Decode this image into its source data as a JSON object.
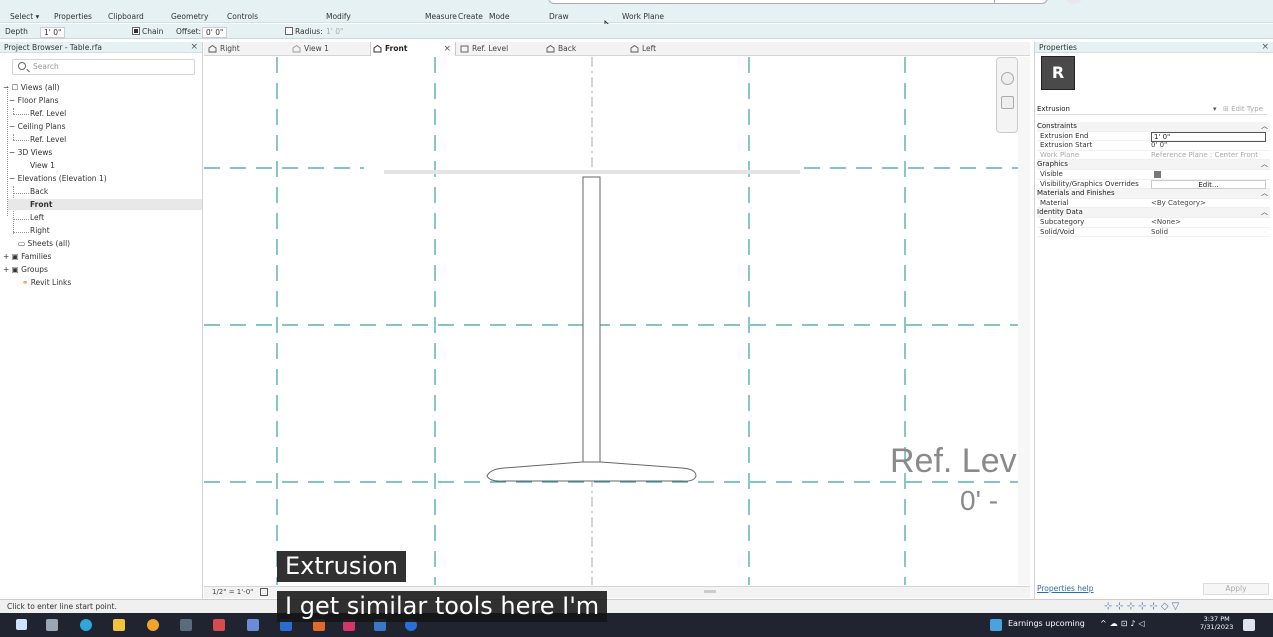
{
  "ribbon": {
    "items": [
      "Select",
      "Properties",
      "Clipboard",
      "Geometry",
      "Controls",
      "Modify",
      "Measure",
      "Create",
      "Mode",
      "Draw",
      "Work Plane"
    ]
  },
  "options": {
    "depth_label": "Depth",
    "depth_value": "1' 0\"",
    "chain_label": "Chain",
    "offset_label": "Offset:",
    "offset_value": "0' 0\"",
    "radius_label": "Radius:",
    "radius_value": "1' 0\""
  },
  "project_browser": {
    "title": "Project Browser - Table.rfa",
    "search_placeholder": "Search",
    "items": [
      {
        "label": "Views (all)"
      },
      {
        "label": "Floor Plans"
      },
      {
        "label": "Ref. Level"
      },
      {
        "label": "Ceiling Plans"
      },
      {
        "label": "Ref. Level"
      },
      {
        "label": "3D Views"
      },
      {
        "label": "View 1"
      },
      {
        "label": "Elevations (Elevation 1)"
      },
      {
        "label": "Back"
      },
      {
        "label": "Front"
      },
      {
        "label": "Left"
      },
      {
        "label": "Right"
      },
      {
        "label": "Sheets (all)"
      },
      {
        "label": "Families"
      },
      {
        "label": "Groups"
      },
      {
        "label": "Revit Links"
      }
    ]
  },
  "tabs": [
    {
      "label": "Right"
    },
    {
      "label": "View 1"
    },
    {
      "label": "Front",
      "active": true
    },
    {
      "label": "Ref. Level"
    },
    {
      "label": "Back"
    },
    {
      "label": "Left"
    }
  ],
  "canvas": {
    "ref_label": "Ref. Lev",
    "ref_value": "0' -"
  },
  "view_control": {
    "scale": "1/2\" = 1'-0\""
  },
  "properties": {
    "title": "Properties",
    "type_letter": "R",
    "type_name": "Extrusion",
    "edit_type": "Edit Type",
    "rows": [
      {
        "kind": "group",
        "label": "Constraints"
      },
      {
        "kind": "input",
        "label": "Extrusion End",
        "value": "1' 0\""
      },
      {
        "kind": "text",
        "label": "Extrusion Start",
        "value": "0' 0\""
      },
      {
        "kind": "dim",
        "label": "Work Plane",
        "value": "Reference Plane : Center Front"
      },
      {
        "kind": "group",
        "label": "Graphics"
      },
      {
        "kind": "check",
        "label": "Visible",
        "value": true
      },
      {
        "kind": "button",
        "label": "Visibility/Graphics Overrides",
        "value": "Edit..."
      },
      {
        "kind": "group",
        "label": "Materials and Finishes"
      },
      {
        "kind": "text",
        "label": "Material",
        "value": "<By Category>"
      },
      {
        "kind": "group",
        "label": "Identity Data"
      },
      {
        "kind": "text",
        "label": "Subcategory",
        "value": "<None>"
      },
      {
        "kind": "text",
        "label": "Solid/Void",
        "value": "Solid"
      }
    ],
    "help_link": "Properties help",
    "apply_label": "Apply"
  },
  "status": {
    "text": "Click to enter line start point."
  },
  "taskbar": {
    "news": "Earnings upcoming",
    "time": "3:37 PM",
    "date": "7/31/2023"
  },
  "captions": {
    "line1": "Extrusion",
    "line2": "I get similar tools here I'm"
  },
  "colors": {
    "ribbon_bg": "#e6f1f3",
    "ref_plane": "#3aa0a8",
    "taskbar": "#1f2430"
  }
}
